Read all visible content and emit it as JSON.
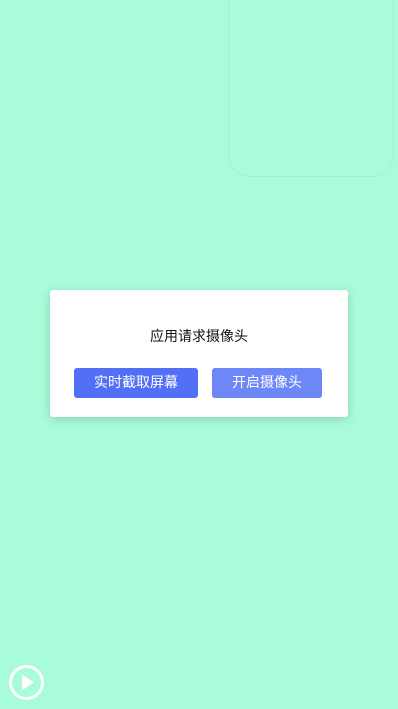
{
  "dialog": {
    "title": "应用请求摄像头",
    "capture_button_label": "实时截取屏幕",
    "camera_button_label": "开启摄像头"
  },
  "colors": {
    "background": "#a9fcd9",
    "primary_button": "#536ff6",
    "secondary_button": "#6d87f7"
  },
  "icons": {
    "play": "play-circle-icon"
  }
}
